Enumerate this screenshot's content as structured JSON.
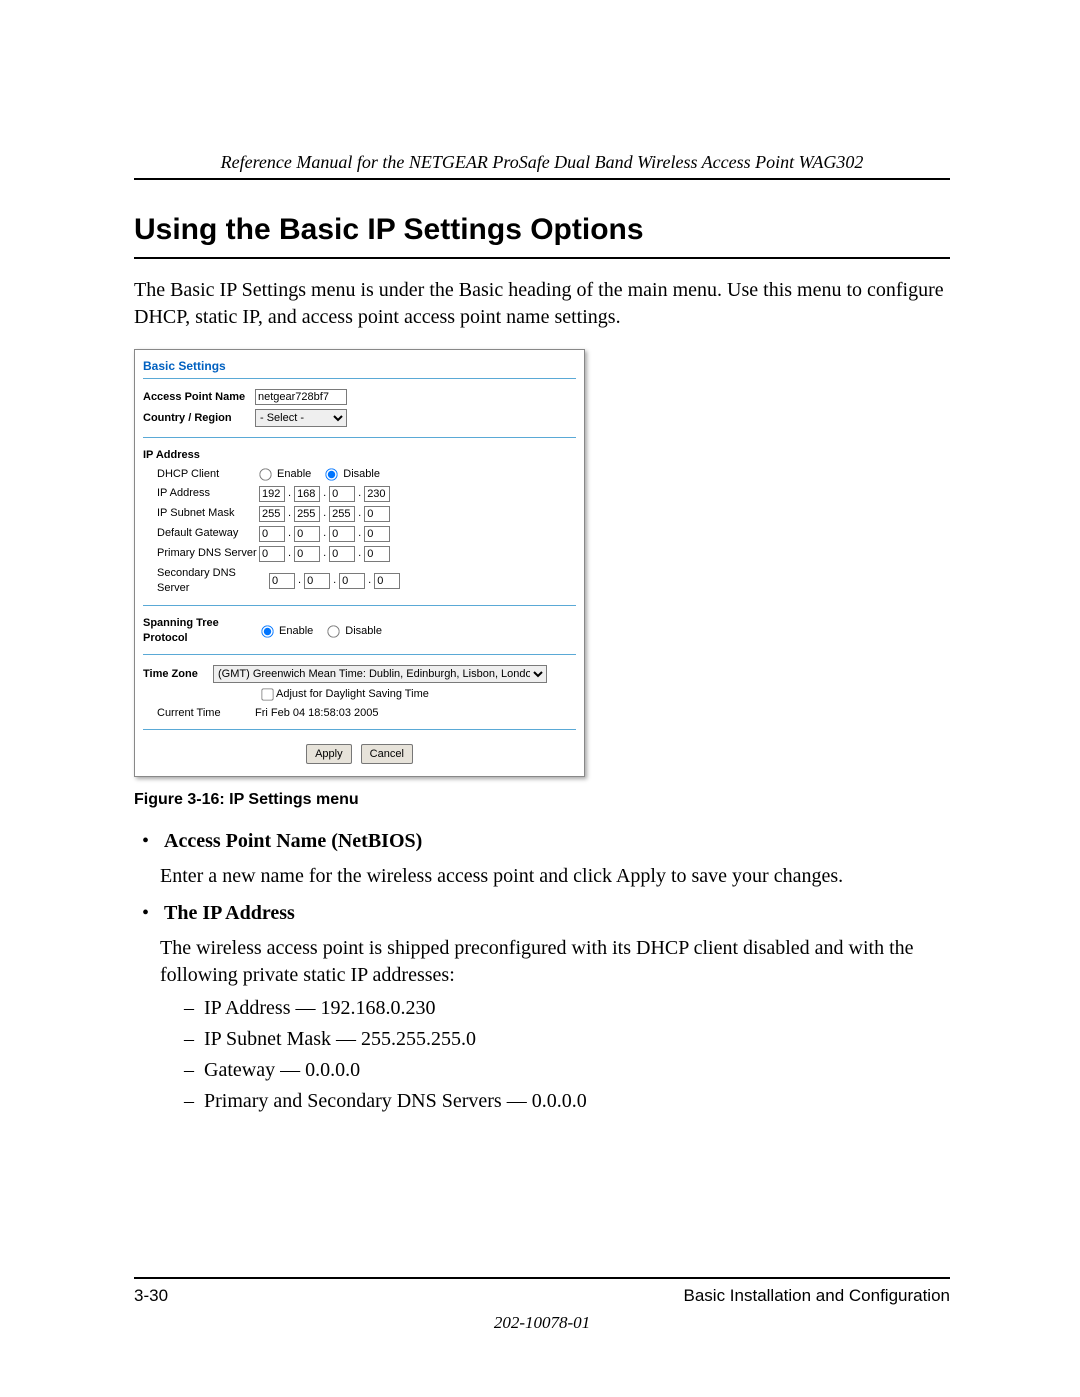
{
  "header": {
    "manual_title": "Reference Manual for the NETGEAR ProSafe Dual Band Wireless Access Point WAG302"
  },
  "section": {
    "title": "Using the Basic IP Settings Options"
  },
  "intro_para": "The Basic IP Settings menu is under the Basic heading of the main menu. Use this menu to configure DHCP, static IP, and access point access point name settings.",
  "figure": {
    "panel_title": "Basic Settings",
    "ap_name_label": "Access Point Name",
    "ap_name_value": "netgear728bf7",
    "region_label": "Country / Region",
    "region_value": "- Select -",
    "ip_section_label": "IP Address",
    "dhcp_label": "DHCP Client",
    "dhcp_enable": "Enable",
    "dhcp_disable": "Disable",
    "dhcp_selected": "disable",
    "ip_addr_label": "IP Address",
    "ip_addr": [
      "192",
      "168",
      "0",
      "230"
    ],
    "subnet_label": "IP Subnet Mask",
    "subnet": [
      "255",
      "255",
      "255",
      "0"
    ],
    "gateway_label": "Default Gateway",
    "gateway": [
      "0",
      "0",
      "0",
      "0"
    ],
    "pdns_label": "Primary DNS Server",
    "pdns": [
      "0",
      "0",
      "0",
      "0"
    ],
    "sdns_label": "Secondary DNS Server",
    "sdns": [
      "0",
      "0",
      "0",
      "0"
    ],
    "stp_label": "Spanning Tree Protocol",
    "stp_enable": "Enable",
    "stp_disable": "Disable",
    "stp_selected": "enable",
    "tz_label": "Time Zone",
    "tz_value": "(GMT) Greenwich Mean Time: Dublin, Edinburgh, Lisbon, London",
    "dst_label": "Adjust for Daylight Saving Time",
    "cur_time_label": "Current Time",
    "cur_time_value": "Fri Feb 04 18:58:03 2005",
    "apply_btn": "Apply",
    "cancel_btn": "Cancel",
    "caption": "Figure 3-16: IP Settings menu"
  },
  "bullets": {
    "b1_title": "Access Point Name (NetBIOS)",
    "b1_text": "Enter a new name for the wireless access point and click Apply to save your changes.",
    "b2_title": "The IP Address",
    "b2_text": "The wireless access point is shipped preconfigured with its DHCP client disabled and with the following private static IP addresses:",
    "b2_items": [
      "IP Address — 192.168.0.230",
      "IP Subnet Mask — 255.255.255.0",
      "Gateway — 0.0.0.0",
      "Primary and Secondary DNS Servers — 0.0.0.0"
    ]
  },
  "footer": {
    "page_num": "3-30",
    "section_name": "Basic Installation and Configuration",
    "doc_num": "202-10078-01"
  }
}
